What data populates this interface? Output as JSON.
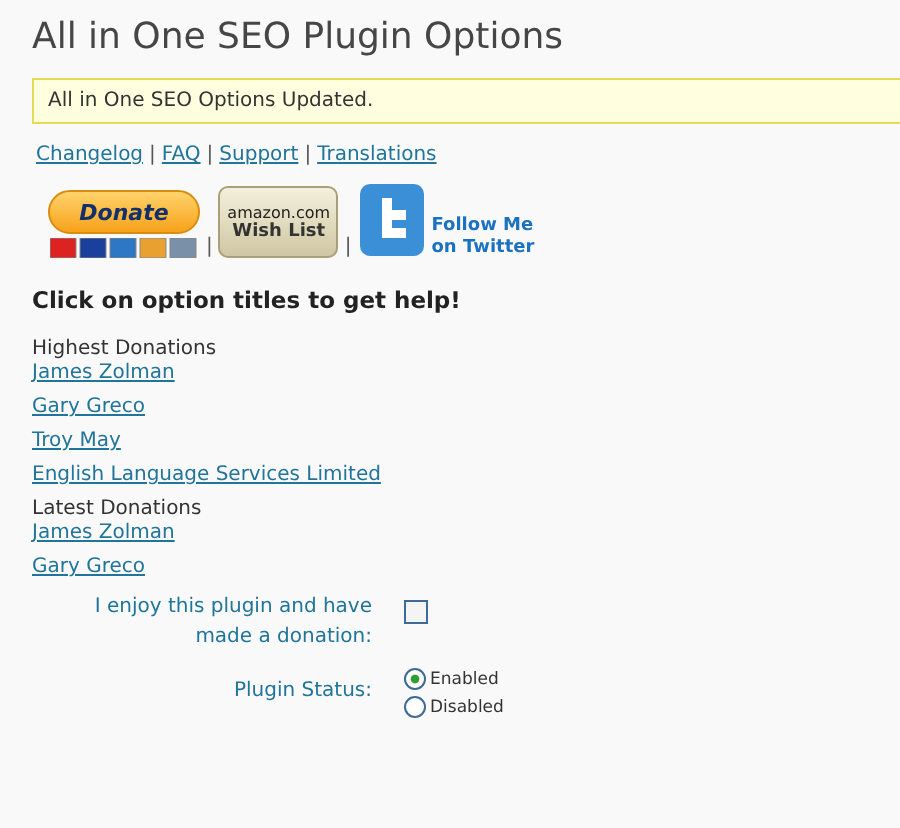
{
  "title": "All in One SEO Plugin Options",
  "notice": "All in One SEO Options Updated.",
  "links": [
    "Changelog",
    "FAQ",
    "Support",
    "Translations"
  ],
  "link_separators": [
    "|",
    "|",
    "|"
  ],
  "badge_separators": [
    "|",
    "|"
  ],
  "badges": {
    "donate": "Donate",
    "amazon": "amazon.com",
    "wishlist": "Wish List",
    "twitter": "Follow Me on Twitter"
  },
  "help_heading": "Click on option titles to get help!",
  "donation_lists": [
    {
      "heading": "Highest Donations",
      "names": [
        "James Zolman",
        "Gary Greco",
        "Troy May",
        "English Language Services Limited"
      ]
    },
    {
      "heading": "Latest Donations",
      "names": [
        "James Zolman",
        "Gary Greco"
      ]
    }
  ],
  "donation_option": {
    "label": "I enjoy this plugin and have made a donation:",
    "checked": false
  },
  "plugin_status": {
    "label": "Plugin Status:",
    "options": [
      {
        "label": "Enabled",
        "selected": true
      },
      {
        "label": "Disabled",
        "selected": false
      }
    ]
  }
}
